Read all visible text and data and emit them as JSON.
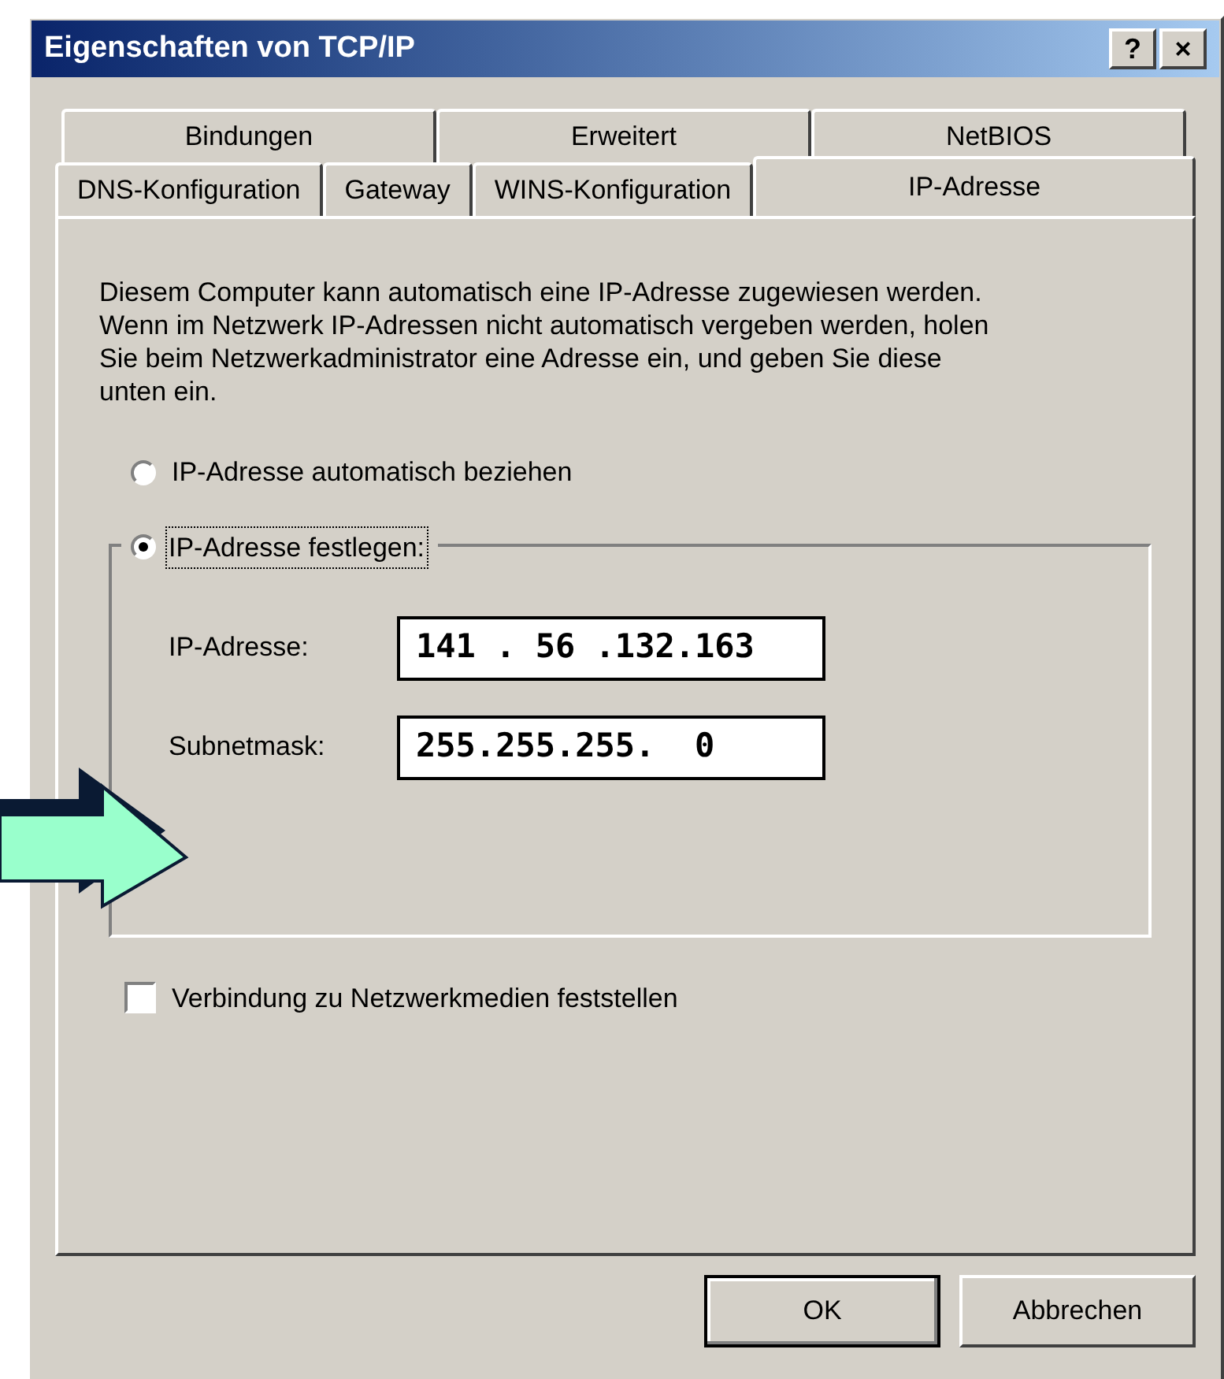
{
  "window": {
    "title": "Eigenschaften von TCP/IP",
    "title_buttons": [
      "?",
      "×"
    ]
  },
  "tab_rows": [
    [
      {
        "label": "Bindungen",
        "selected": false
      },
      {
        "label": "Erweitert",
        "selected": false
      },
      {
        "label": "NetBIOS",
        "selected": false
      }
    ],
    [
      {
        "label": "DNS-Konfiguration",
        "selected": false
      },
      {
        "label": "Gateway",
        "selected": false
      },
      {
        "label": "WINS-Konfiguration",
        "selected": false
      },
      {
        "label": "IP-Adresse",
        "selected": true
      }
    ]
  ],
  "description": "Diesem Computer kann automatisch eine IP-Adresse zugewiesen werden. Wenn im Netzwerk IP-Adressen nicht automatisch vergeben werden, holen Sie beim Netzwerkadministrator eine Adresse ein, und geben Sie diese unten ein.",
  "radios": [
    {
      "label": "IP-Adresse automatisch beziehen",
      "selected": false
    },
    {
      "label": "IP-Adresse festlegen:",
      "selected": true
    }
  ],
  "fields": [
    {
      "label": "IP-Adresse:",
      "value": "141 . 56 .132.163"
    },
    {
      "label": "Subnetmask:",
      "value": "255.255.255.  0"
    }
  ],
  "checkbox": {
    "label": "Verbindung zu Netzwerkmedien feststellen",
    "checked": false
  },
  "buttons": [
    "OK",
    "Abbrechen"
  ]
}
